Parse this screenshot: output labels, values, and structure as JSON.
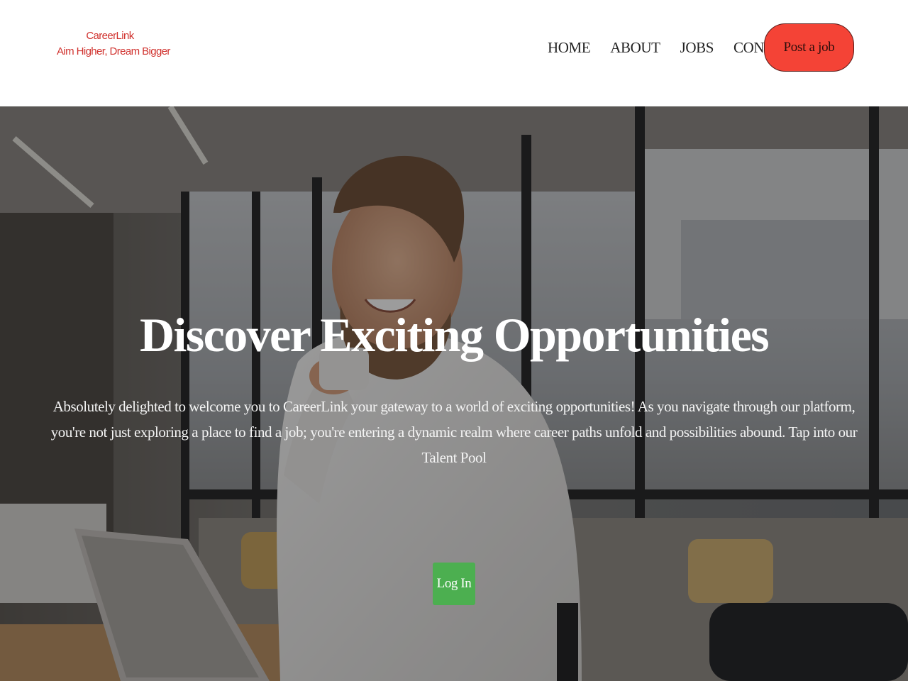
{
  "brand": {
    "name": "CareerLink",
    "tagline": "Aim Higher, Dream Bigger"
  },
  "nav": {
    "links": [
      "HOME",
      "ABOUT",
      "JOBS",
      "CONTACT"
    ],
    "post_job_label": "Post a job"
  },
  "hero": {
    "title": "Discover Exciting Opportunities",
    "text": "Absolutely delighted to welcome you to CareerLink your gateway to a world of exciting opportunities! As you navigate through our platform, you're not just exploring a place to find a job; you're entering a dynamic realm where career paths unfold and possibilities abound. Tap into our Talent Pool",
    "login_label": "Log In"
  },
  "colors": {
    "brand_red": "#d0312d",
    "post_job_bg": "#f44336",
    "login_bg": "#4caf50"
  }
}
